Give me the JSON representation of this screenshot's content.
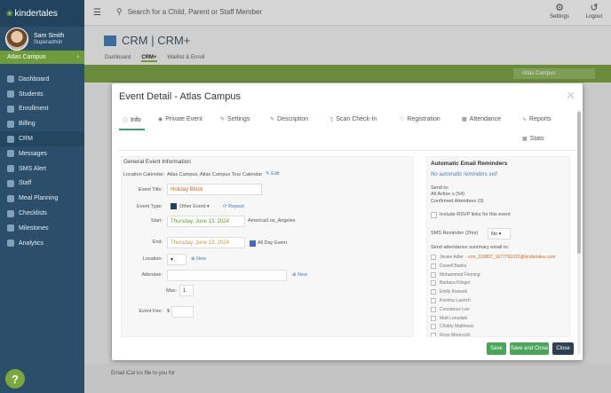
{
  "app": {
    "logo": "kindertales"
  },
  "user": {
    "name": "Sam Smith",
    "role": "Superadmin"
  },
  "campus": {
    "label": "Atlas Campus"
  },
  "nav": [
    "Dashboard",
    "Students",
    "Enrollment",
    "Billing",
    "CRM",
    "Messages",
    "SMS Alert",
    "Staff",
    "Meal Planning",
    "Checklists",
    "Milestones",
    "Analytics"
  ],
  "topbar": {
    "search_placeholder": "Search for a Child, Parent or Staff Member",
    "settings": "Settings",
    "logout": "Logout"
  },
  "crm": {
    "title": "CRM | CRM+",
    "tabs": [
      "Dashboard",
      "CRM+",
      "Waitlist & Enroll"
    ]
  },
  "greenbar": {
    "campus_select": "Atlas Campus"
  },
  "footer": {
    "text": "Email iCal ics file to you for"
  },
  "modal": {
    "title": "Event Detail - Atlas Campus",
    "tabs": [
      "Info",
      "Private Event",
      "Settings",
      "Description",
      "Scan Check-In",
      "Registration",
      "Attendance",
      "Reports",
      "Stats"
    ],
    "section": "General Event Information",
    "location_label": "Location Calendar:",
    "location_value": "Atlas Campus, Atlas Campus Tour Calendar",
    "edit": "Edit",
    "event_title_label": "Event Title:",
    "event_title": "Holiday Block",
    "event_type_label": "Event Type:",
    "event_type": "Other Event",
    "repeat": "Repeat",
    "start_label": "Start:",
    "start_date": "Thursday, June 13, 2024",
    "timezone": "America/Los_Angeles",
    "end_label": "End:",
    "end_date": "Thursday, June 13, 2024",
    "all_day": "All Day Event",
    "location_field_label": "Location:",
    "new": "New",
    "attendee_label": "Attendee:",
    "max_label": "Max:",
    "max_value": "1",
    "fee_label": "Event Fee:",
    "fee_currency": "$",
    "reminders_title": "Automatic Email Reminders",
    "no_reminders": "No automatic reminders set!",
    "send_to": "Send to:",
    "all_active": "All Active s (54)",
    "confirmed": "Confirmed Attendees (0)",
    "rsvp": "Include RSVP links for this event",
    "sms_label": "SMS Reminder (2hrs)",
    "sms_value": "No",
    "summary_label": "Send attendance summary email to:",
    "staff": [
      {
        "name": "Jessie Adler",
        "email": "- crm_103807_1677791022@kindertales.com"
      },
      {
        "name": "Duwell Banks",
        "email": ""
      },
      {
        "name": "Mohammed Fleming",
        "email": ""
      },
      {
        "name": "Barbara Klinger",
        "email": ""
      },
      {
        "name": "Emily Kwasek",
        "email": ""
      },
      {
        "name": "Krishna Laurich",
        "email": ""
      },
      {
        "name": "Constance Lee",
        "email": ""
      },
      {
        "name": "Matt Lonsdale",
        "email": ""
      },
      {
        "name": "Chiddy Matthews",
        "email": ""
      },
      {
        "name": "Rose Morecock",
        "email": ""
      }
    ],
    "save": "Save",
    "save_close": "Save and Close",
    "close": "Close"
  }
}
